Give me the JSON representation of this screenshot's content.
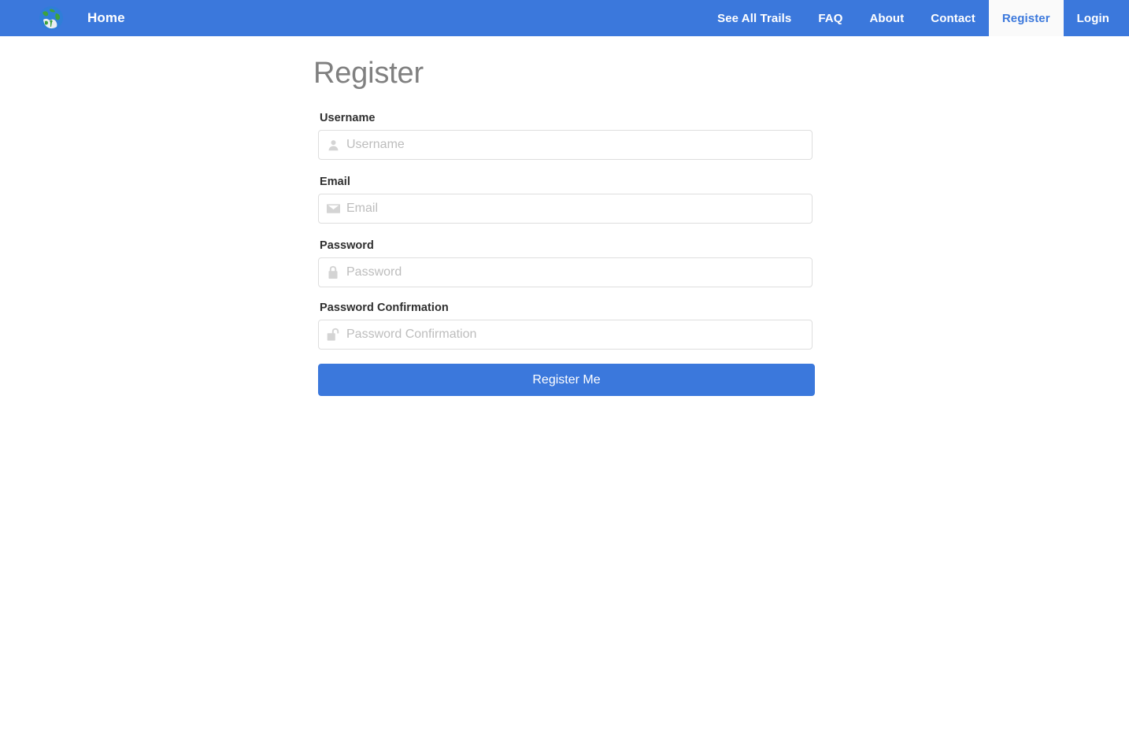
{
  "colors": {
    "navbar_bg": "#3b78dc",
    "navbar_active_bg": "#fafafa",
    "navbar_active_text": "#3b78dc",
    "page_bg": "#ffffff",
    "title_text": "#808080",
    "label_text": "#2f2f2f",
    "input_border": "#dedede",
    "placeholder_text": "#bdbdbd",
    "icon_gray": "#d4d4d4",
    "button_bg": "#3b78dc",
    "button_text": "#ffffff"
  },
  "navbar": {
    "logo_icon": "globe-earth-icon",
    "home_label": "Home",
    "right_items": [
      {
        "label": "See All Trails",
        "active": false
      },
      {
        "label": "FAQ",
        "active": false
      },
      {
        "label": "About",
        "active": false
      },
      {
        "label": "Contact",
        "active": false
      },
      {
        "label": "Register",
        "active": true
      },
      {
        "label": "Login",
        "active": false
      }
    ]
  },
  "main": {
    "title": "Register",
    "fields": [
      {
        "label": "Username",
        "placeholder": "Username",
        "value": "",
        "icon": "user-icon",
        "type": "text"
      },
      {
        "label": "Email",
        "placeholder": "Email",
        "value": "",
        "icon": "envelope-icon",
        "type": "text"
      },
      {
        "label": "Password",
        "placeholder": "Password",
        "value": "",
        "icon": "lock-closed-icon",
        "type": "text"
      },
      {
        "label": "Password Confirmation",
        "placeholder": "Password Confirmation",
        "value": "",
        "icon": "lock-open-icon",
        "type": "text"
      }
    ],
    "submit_label": "Register Me"
  }
}
